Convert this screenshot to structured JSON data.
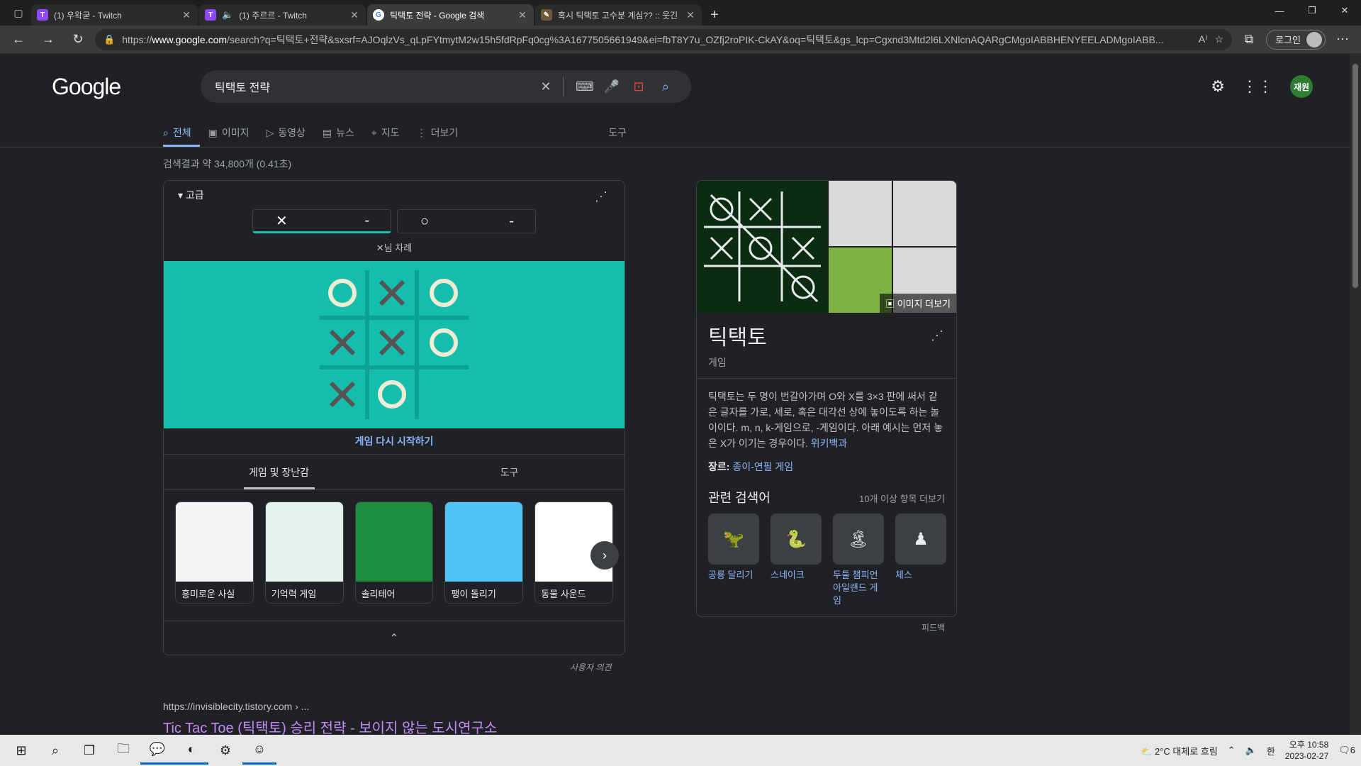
{
  "browser": {
    "tabs": [
      {
        "title": "(1) 우왁굳 - Twitch",
        "favicon": "twitch-icon",
        "active": false,
        "muted_icon": false
      },
      {
        "title": "(1) 주르르 - Twitch",
        "favicon": "twitch-icon",
        "active": false,
        "muted_icon": true
      },
      {
        "title": "틱택토 전략 - Google 검색",
        "favicon": "google-icon",
        "active": true,
        "muted_icon": false
      },
      {
        "title": "혹시 틱택토 고수분 계심?? :: 웃긴",
        "favicon": "blog-icon",
        "active": false,
        "muted_icon": false
      }
    ],
    "url_prefix": "https://",
    "url_host": "www.google.com",
    "url_rest": "/search?q=틱택토+전략&sxsrf=AJOqlzVs_qLpFYtmytM2w15h5fdRpFq0cg%3A1677505661949&ei=fbT8Y7u_OZfj2roPIK-CkAY&oq=틱택토&gs_lcp=Cgxnd3Mtd2l6LXNlcnAQARgCMgoIABBHENYEELADMgoIABB...",
    "login_label": "로그인"
  },
  "google": {
    "logo": "Google",
    "query": "틱택토 전략",
    "avatar_label": "재원",
    "tabs": [
      {
        "label": "전체",
        "icon": "search-icon",
        "active": true
      },
      {
        "label": "이미지",
        "icon": "image-icon",
        "active": false
      },
      {
        "label": "동영상",
        "icon": "video-icon",
        "active": false
      },
      {
        "label": "뉴스",
        "icon": "news-icon",
        "active": false
      },
      {
        "label": "지도",
        "icon": "map-pin-icon",
        "active": false
      },
      {
        "label": "더보기",
        "icon": "more-vert-icon",
        "active": false
      }
    ],
    "tools_label": "도구",
    "result_stats": "검색결과 약 34,800개 (0.41초)"
  },
  "game": {
    "difficulty": "고급",
    "player_x_score": "-",
    "player_o_score": "-",
    "turn_text": "님 차례",
    "board": [
      "O",
      "X",
      "O",
      "X",
      "X",
      "O",
      "X",
      "O",
      ""
    ],
    "restart_label": "게임 다시 시작하기",
    "tabs": [
      "게임 및 장난감",
      "도구"
    ],
    "tiles": [
      {
        "label": "흥미로운 사실",
        "color": "#f1f3f4"
      },
      {
        "label": "기억력 게임",
        "color": "#e0f2e9"
      },
      {
        "label": "솔리테어",
        "color": "#1e8e3e"
      },
      {
        "label": "팽이 돌리기",
        "color": "#4fc3f7"
      },
      {
        "label": "동물 사운드",
        "color": "#ffffff"
      }
    ],
    "feedback": "사용자 의견",
    "colors": {
      "board": "#14bdac",
      "lines": "#0da192"
    }
  },
  "knowledge_panel": {
    "more_images": "이미지 더보기",
    "title": "틱택토",
    "subtitle": "게임",
    "description": "틱택토는 두 명이 번갈아가며 O와 X를 3×3 판에 써서 같은 글자를 가로, 세로, 혹은 대각선 상에 놓이도록 하는 놀이이다. m, n, k-게임으로, -게임이다. 아래 예시는 먼저 놓은 X가 이기는 경우이다.",
    "source": "위키백과",
    "genre_label": "장르:",
    "genre_value": "종이-연필 게임",
    "related_heading": "관련 검색어",
    "related_more": "10개 이상 항목 더보기",
    "related": [
      {
        "label": "공룡 달리기",
        "icon": "dino-icon"
      },
      {
        "label": "스네이크",
        "icon": "snake-icon"
      },
      {
        "label": "두들 챔피언 아일랜드 게임",
        "icon": "island-icon"
      },
      {
        "label": "체스",
        "icon": "chess-icon"
      }
    ],
    "feedback": "피드백"
  },
  "result": {
    "cite": "https://invisiblecity.tistory.com › ...",
    "title": "Tic Tac Toe (틱택토) 승리 전략 - 보이지 않는 도시연구소"
  },
  "taskbar": {
    "weather": "2°C  대체로 흐림",
    "ime": "한",
    "time": "오후 10:58",
    "date": "2023-02-27",
    "notifications": "6"
  }
}
